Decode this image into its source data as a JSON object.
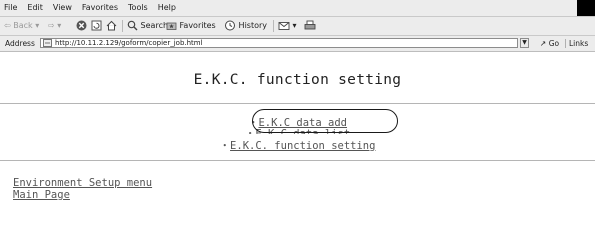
{
  "menubar": {
    "items": [
      "File",
      "Edit",
      "View",
      "Favorites",
      "Tools",
      "Help"
    ]
  },
  "toolbar": {
    "back": "Back",
    "search": "Search",
    "favorites": "Favorites",
    "history": "History"
  },
  "addressbar": {
    "label": "Address",
    "url": "http://10.11.2.129/goform/copier_job.html",
    "go": "Go",
    "links": "Links"
  },
  "page": {
    "title": "E.K.C. function setting",
    "menu": [
      {
        "bullet": "・",
        "label": "E.K.C data add"
      },
      {
        "bullet": "・",
        "label": "E.K.C data list"
      },
      {
        "bullet": "・",
        "label": "E.K.C. function setting"
      }
    ],
    "footer_links": [
      "Environment Setup menu",
      "Main Page"
    ]
  }
}
